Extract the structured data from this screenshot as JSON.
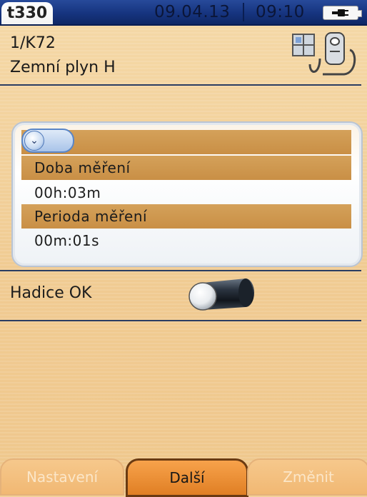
{
  "status_bar": {
    "device_tab": "t330",
    "date": "09.04.13",
    "time": "09:10"
  },
  "header": {
    "line1": "1/K72",
    "line2": "Zemní plyn H"
  },
  "panel": {
    "rows": [
      {
        "label": "Doba měření",
        "value": "00h:03m"
      },
      {
        "label": "Perioda měření",
        "value": "00m:01s"
      }
    ]
  },
  "hose": {
    "label": "Hadice OK"
  },
  "buttons": {
    "left": "Nastavení",
    "middle": "Další",
    "right": "Změnit"
  },
  "colors": {
    "accent_band": "#c98f45",
    "status_bar": "#16347f",
    "primary_button": "#e07f24"
  }
}
